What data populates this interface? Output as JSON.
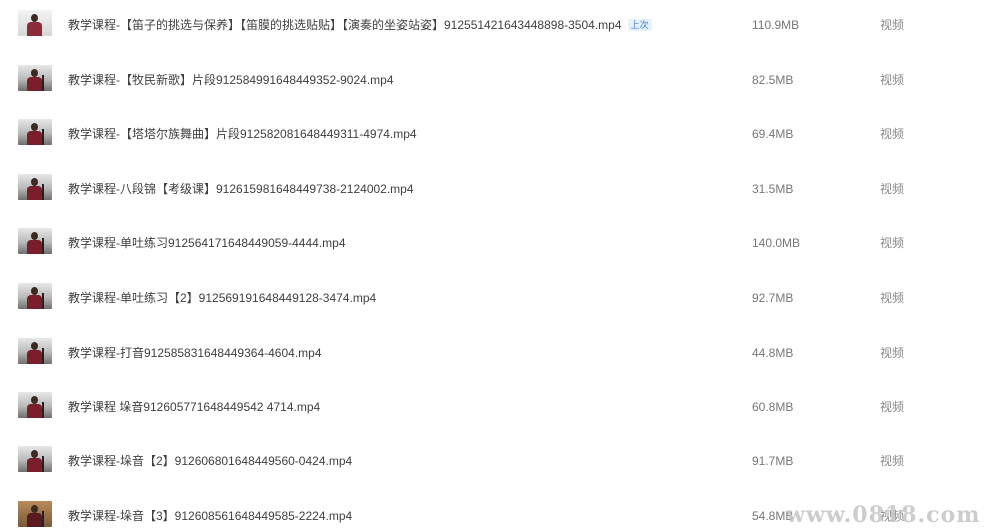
{
  "files": [
    {
      "name": "教学课程-【笛子的挑选与保养】【笛膜的挑选贴贴】【演奏的坐姿站姿】91255142164344889​8-3504.mp4",
      "badge": "上次",
      "size": "110.9MB",
      "type": "视频"
    },
    {
      "name": "教学课程-【牧民新歌】片段912584991648449352-9024.mp4",
      "badge": "",
      "size": "82.5MB",
      "type": "视频"
    },
    {
      "name": "教学课程-【塔塔尔族舞曲】片段912582081648449311-4974.mp4",
      "badge": "",
      "size": "69.4MB",
      "type": "视频"
    },
    {
      "name": "教学课程-八段锦【考级课】912615981648449738-2124002.mp4",
      "badge": "",
      "size": "31.5MB",
      "type": "视频"
    },
    {
      "name": "教学课程-单吐练习912564171648449059-4444.mp4",
      "badge": "",
      "size": "140.0MB",
      "type": "视频"
    },
    {
      "name": "教学课程-单吐练习【2】912569191648449128-3474.mp4",
      "badge": "",
      "size": "92.7MB",
      "type": "视频"
    },
    {
      "name": "教学课程-打音912585831648449364-4604.mp4",
      "badge": "",
      "size": "44.8MB",
      "type": "视频"
    },
    {
      "name": "教学课程 垛音912605771648449542 4714.mp4",
      "badge": "",
      "size": "60.8MB",
      "type": "视频"
    },
    {
      "name": "教学课程-垛音【2】912606801648449560-0424.mp4",
      "badge": "",
      "size": "91.7MB",
      "type": "视频"
    },
    {
      "name": "教学课程-垛音【3】912608561648449585-2224.mp4",
      "badge": "",
      "size": "54.8MB",
      "type": "视频"
    }
  ],
  "watermark": "www.0818.com"
}
